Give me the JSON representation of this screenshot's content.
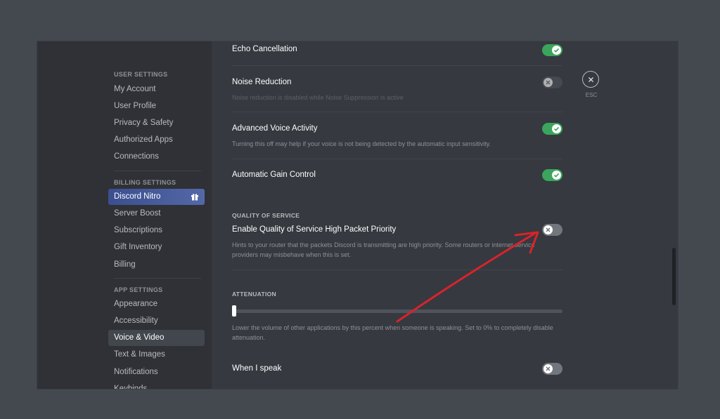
{
  "sidebar": {
    "user_settings_header": "USER SETTINGS",
    "user_items": [
      "My Account",
      "User Profile",
      "Privacy & Safety",
      "Authorized Apps",
      "Connections"
    ],
    "billing_settings_header": "BILLING SETTINGS",
    "billing_items": [
      "Discord Nitro",
      "Server Boost",
      "Subscriptions",
      "Gift Inventory",
      "Billing"
    ],
    "app_settings_header": "APP SETTINGS",
    "app_items": [
      "Appearance",
      "Accessibility",
      "Voice & Video",
      "Text & Images",
      "Notifications",
      "Keybinds"
    ],
    "selected_item": "Voice & Video"
  },
  "main": {
    "echo_cancellation": {
      "title": "Echo Cancellation",
      "enabled": true
    },
    "noise_reduction": {
      "title": "Noise Reduction",
      "description": "Noise reduction is disabled while Noise Suppression is active",
      "enabled": false,
      "disabled": true
    },
    "advanced_voice_activity": {
      "title": "Advanced Voice Activity",
      "description": "Turning this off may help if your voice is not being detected by the automatic input sensitivity.",
      "enabled": true
    },
    "automatic_gain_control": {
      "title": "Automatic Gain Control",
      "enabled": true
    },
    "quality_of_service": {
      "header": "QUALITY OF SERVICE",
      "title": "Enable Quality of Service High Packet Priority",
      "description": "Hints to your router that the packets Discord is transmitting are high priority. Some routers or internet service providers may misbehave when this is set.",
      "enabled": false
    },
    "attenuation": {
      "header": "ATTENUATION",
      "value_percent": 0,
      "description": "Lower the volume of other applications by this percent when someone is speaking. Set to 0% to completely disable attenuation."
    },
    "when_i_speak": {
      "title": "When I speak",
      "enabled": false
    }
  },
  "close": {
    "label": "ESC",
    "icon": "close-icon"
  },
  "annotation": {
    "color": "#d9232b",
    "icon": "red-arrow"
  },
  "colors": {
    "toggle_on": "#3ba55c",
    "toggle_off": "#72767d",
    "nitro": "#5468a8"
  }
}
